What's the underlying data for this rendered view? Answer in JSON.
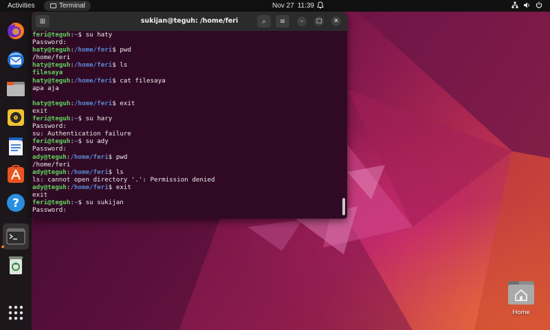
{
  "topbar": {
    "activities": "Activities",
    "app_name": "Terminal",
    "date": "Nov 27",
    "time": "11:39",
    "icons": [
      "notification-bell-icon",
      "network-icon",
      "volume-icon",
      "power-icon"
    ]
  },
  "dock": {
    "apps": [
      {
        "name": "Firefox",
        "icon": "firefox-icon"
      },
      {
        "name": "Thunderbird",
        "icon": "thunderbird-icon"
      },
      {
        "name": "Files",
        "icon": "files-icon"
      },
      {
        "name": "Rhythmbox",
        "icon": "rhythmbox-icon"
      },
      {
        "name": "LibreOffice Writer",
        "icon": "writer-icon"
      },
      {
        "name": "Ubuntu Software",
        "icon": "software-icon"
      },
      {
        "name": "Help",
        "icon": "help-icon"
      },
      {
        "name": "Terminal",
        "icon": "terminal-icon"
      },
      {
        "name": "Trash",
        "icon": "trash-icon"
      },
      {
        "name": "Show Applications",
        "icon": "app-grid-icon"
      }
    ]
  },
  "terminal": {
    "title": "sukijan@teguh: /home/feri",
    "new_tab_symbol": "⊞",
    "search_symbol": "⌕",
    "menu_symbol": "≡",
    "minimize_symbol": "–",
    "maximize_symbol": "□",
    "close_symbol": "✕",
    "lines": [
      {
        "user": "feri@teguh",
        "path": "~",
        "cmd": "$ su haty"
      },
      {
        "out": "Password:"
      },
      {
        "user": "haty@teguh",
        "path": "/home/feri",
        "cmd": "$ pwd"
      },
      {
        "out": "/home/feri"
      },
      {
        "user": "haty@teguh",
        "path": "/home/feri",
        "cmd": "$ ls"
      },
      {
        "dir": "filesaya"
      },
      {
        "user": "haty@teguh",
        "path": "/home/feri",
        "cmd": "$ cat filesaya"
      },
      {
        "out": "apa aja"
      },
      {
        "out": ""
      },
      {
        "user": "haty@teguh",
        "path": "/home/feri",
        "cmd": "$ exit"
      },
      {
        "out": "exit"
      },
      {
        "user": "feri@teguh",
        "path": "~",
        "cmd": "$ su hary"
      },
      {
        "out": "Password:"
      },
      {
        "out": "su: Authentication failure"
      },
      {
        "user": "feri@teguh",
        "path": "~",
        "cmd": "$ su ady"
      },
      {
        "out": "Password:"
      },
      {
        "user": "ady@teguh",
        "path": "/home/feri",
        "cmd": "$ pwd"
      },
      {
        "out": "/home/feri"
      },
      {
        "user": "ady@teguh",
        "path": "/home/feri",
        "cmd": "$ ls"
      },
      {
        "out": "ls: cannot open directory '.': Permission denied"
      },
      {
        "user": "ady@teguh",
        "path": "/home/feri",
        "cmd": "$ exit"
      },
      {
        "out": "exit"
      },
      {
        "user": "feri@teguh",
        "path": "~",
        "cmd": "$ su sukijan"
      },
      {
        "out": "Password:"
      }
    ]
  },
  "desktop": {
    "home_label": "Home"
  },
  "colors": {
    "terminal_bg": "#300a24",
    "prompt_user": "#5fd35f",
    "prompt_path": "#5b86d4",
    "running_indicator": "#f07a2a"
  }
}
